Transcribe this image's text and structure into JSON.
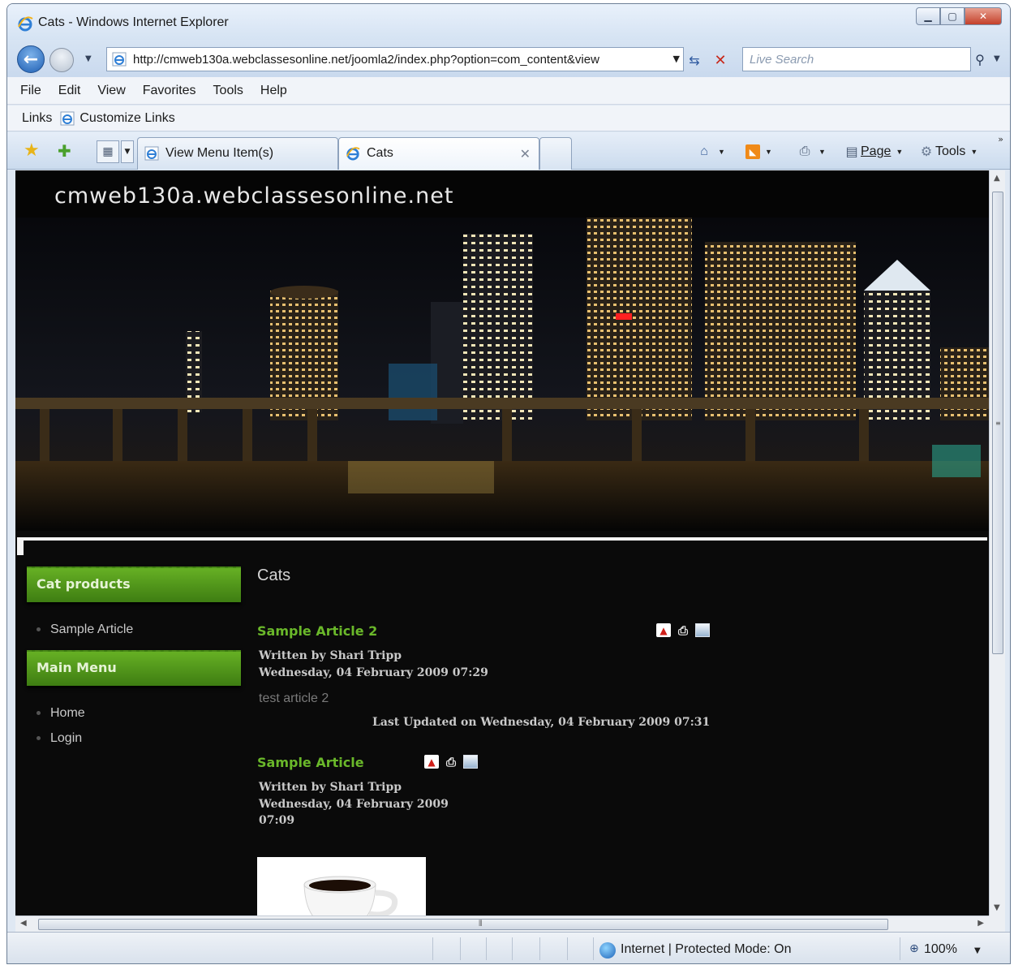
{
  "window": {
    "title": "Cats - Windows Internet Explorer"
  },
  "address": {
    "url": "http://cmweb130a.webclassesonline.net/joomla2/index.php?option=com_content&view",
    "search_placeholder": "Live Search"
  },
  "menubar": {
    "items": [
      "File",
      "Edit",
      "View",
      "Favorites",
      "Tools",
      "Help"
    ]
  },
  "links": {
    "label": "Links",
    "item": "Customize Links"
  },
  "tabs": [
    {
      "label": "View Menu Item(s)"
    },
    {
      "label": "Cats"
    }
  ],
  "commands": {
    "page": "Page",
    "tools": "Tools"
  },
  "site": {
    "title": "cmweb130a.webclassesonline.net",
    "sidebar": {
      "modules": [
        {
          "title": "Cat products",
          "items": [
            "Sample Article"
          ]
        },
        {
          "title": "Main Menu",
          "items": [
            "Home",
            "Login"
          ]
        }
      ]
    },
    "page_heading": "Cats",
    "articles": [
      {
        "title": "Sample Article 2",
        "author": "Written by Shari Tripp",
        "date": "Wednesday, 04 February 2009 07:29",
        "body": "test article 2",
        "updated": "Last Updated on Wednesday, 04 February 2009 07:31"
      },
      {
        "title": "Sample Article",
        "author": "Written by Shari Tripp",
        "date_line1": "Wednesday, 04 February 2009",
        "date_line2": "07:09"
      }
    ]
  },
  "status": {
    "zone": "Internet | Protected Mode: On",
    "zoom": "100%"
  },
  "icons": {
    "ie": "ie-logo-icon",
    "back": "back-arrow-icon",
    "forward": "forward-arrow-icon",
    "refresh": "refresh-icon",
    "stop": "stop-icon",
    "search": "search-icon",
    "pdf": "pdf-icon",
    "print": "print-icon",
    "email": "email-icon"
  },
  "colors": {
    "accent_green": "#6ab82a",
    "module_green": "#4e9a18",
    "page_bg": "#0a0a0a"
  }
}
